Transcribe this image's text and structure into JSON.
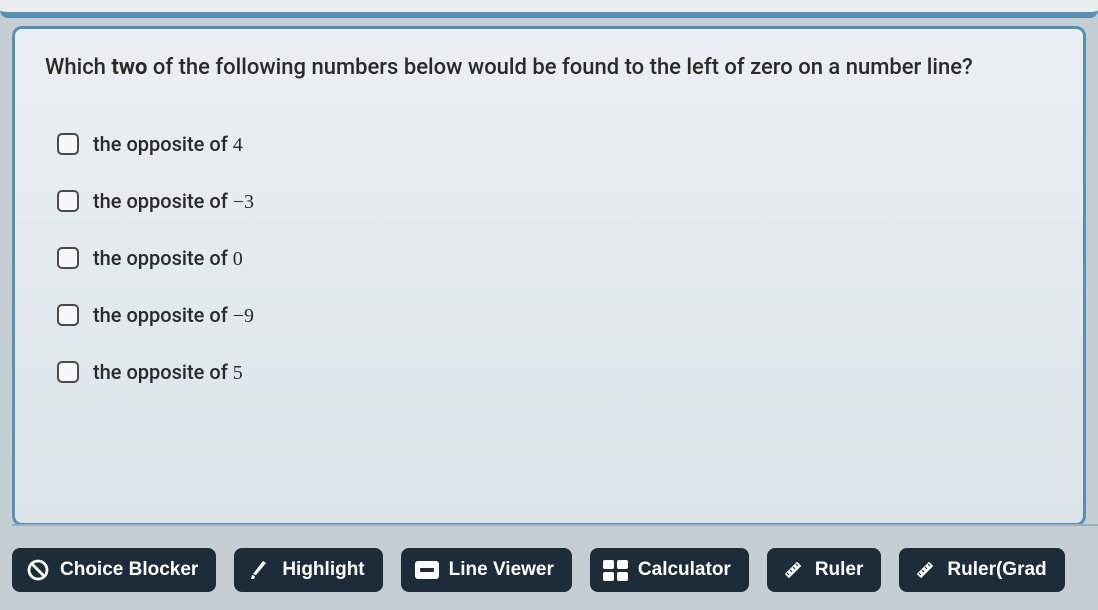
{
  "question": {
    "prefix": "Which ",
    "emphasis": "two",
    "suffix": " of the following numbers below would be found to the left of zero on a number line?"
  },
  "options": [
    {
      "prefix": "the opposite of ",
      "value": "4"
    },
    {
      "prefix": "the opposite of ",
      "value": "−3"
    },
    {
      "prefix": "the opposite of ",
      "value": "0"
    },
    {
      "prefix": "the opposite of ",
      "value": "−9"
    },
    {
      "prefix": "the opposite of ",
      "value": "5"
    }
  ],
  "toolbar": {
    "choice_blocker": "Choice Blocker",
    "highlight": "Highlight",
    "line_viewer": "Line Viewer",
    "calculator": "Calculator",
    "ruler": "Ruler",
    "ruler_grad": "Ruler(Grad"
  }
}
